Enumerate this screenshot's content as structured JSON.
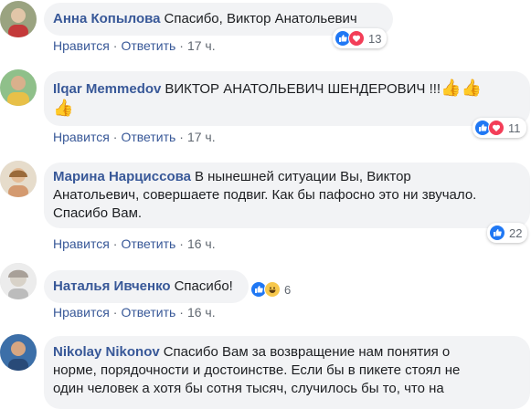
{
  "actions": {
    "like": "Нравится",
    "reply": "Ответить",
    "sep": "·"
  },
  "comments": [
    {
      "author": "Анна Копылова",
      "text": "Спасибо, Виктор Анатольевич",
      "time": "17 ч.",
      "reactions": [
        "like-icon",
        "love-icon"
      ],
      "reaction_count": "13",
      "avatar_color": "#8a9a6a"
    },
    {
      "author": "Ilqar Memmedov",
      "text": "ВИКТОР АНАТОЛЬЕВИЧ ШЕНДЕРОВИЧ !!!",
      "emoji1": "👍👍",
      "emoji2": "👍",
      "time": "17 ч.",
      "reactions": [
        "like-icon",
        "love-icon"
      ],
      "reaction_count": "11",
      "avatar_color": "#6aa06a"
    },
    {
      "author": "Марина Нарциссова",
      "line1": "В нынешней ситуации Вы, Виктор",
      "line2": "Анатольевич, совершаете подвиг. Как бы пафосно это ни звучало.",
      "line3": "Спасибо Вам.",
      "time": "16 ч.",
      "reactions": [
        "like-icon"
      ],
      "reaction_count": "22",
      "avatar_color": "#c8b090"
    },
    {
      "author": "Наталья Ивченко",
      "text": "Спасибо!",
      "time": "16 ч.",
      "reactions": [
        "like-icon",
        "haha-icon"
      ],
      "reaction_count": "6",
      "avatar_color": "#b8b8b8"
    },
    {
      "author": "Nikolay Nikonov",
      "line1": "Спасибо Вам за возвращение нам понятия о",
      "line2": "норме, порядочности и достоинстве. Если бы в пикете стоял не",
      "line3": "один человек а хотя бы сотня тысяч, случилось бы то, что на",
      "avatar_color": "#4a7ab0"
    }
  ],
  "colors": {
    "author": "#385898",
    "bubble": "#f2f3f5",
    "like": "#2078f4",
    "love": "#f33e58",
    "haha": "#f7c84c"
  }
}
